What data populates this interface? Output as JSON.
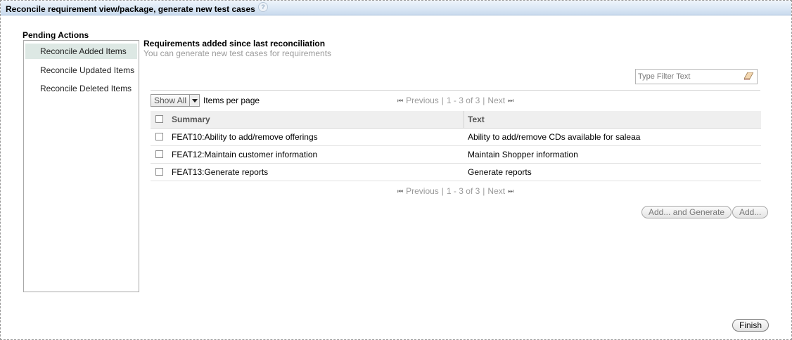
{
  "dialog": {
    "title": "Reconcile requirement view/package, generate new test cases",
    "help_glyph": "?"
  },
  "pending_actions": {
    "title": "Pending Actions",
    "items": [
      {
        "label": "Reconcile Added Items",
        "active": true
      },
      {
        "label": "Reconcile Updated Items",
        "active": false
      },
      {
        "label": "Reconcile Deleted Items",
        "active": false
      }
    ]
  },
  "content": {
    "title": "Requirements added since last reconciliation",
    "subtitle": "You can generate new test cases for requirements"
  },
  "filter": {
    "placeholder": "Type Filter Text",
    "clear_icon": "eraser-icon"
  },
  "pager": {
    "show_all": "Show All",
    "items_per_page": "Items per page",
    "previous": "Previous",
    "range": "1 - 3 of 3",
    "next": "Next",
    "separator": "|"
  },
  "table": {
    "columns": [
      "Summary",
      "Text"
    ],
    "rows": [
      {
        "summary": "FEAT10:Ability to add/remove offerings",
        "text": "Ability to add/remove CDs available for saleaa"
      },
      {
        "summary": "FEAT12:Maintain customer information",
        "text": "Maintain Shopper information"
      },
      {
        "summary": "FEAT13:Generate reports",
        "text": "Generate reports"
      }
    ]
  },
  "buttons": {
    "add_and_generate": "Add... and Generate",
    "add": "Add...",
    "finish": "Finish"
  },
  "colors": {
    "titlebar": "#d9e6f4",
    "active_nav": "#dde8e4",
    "muted_text": "#9a9a9a"
  }
}
